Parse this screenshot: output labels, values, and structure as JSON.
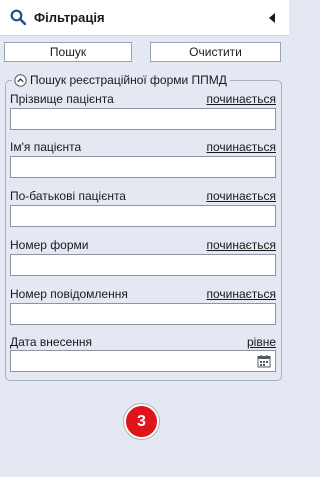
{
  "header": {
    "title": "Фільтрація",
    "search_icon": "search-icon",
    "collapse_icon": "triangle-left-icon"
  },
  "toolbar": {
    "search_label": "Пошук",
    "clear_label": "Очистити"
  },
  "group": {
    "legend": "Пошук реєстраційної форми ППМД",
    "legend_icon": "chevron-up-circle-icon"
  },
  "fields": [
    {
      "label": "Прізвище пацієнта",
      "mode": "починається",
      "value": ""
    },
    {
      "label": "Ім'я пацієнта",
      "mode": "починається",
      "value": ""
    },
    {
      "label": "По-батькові пацієнта",
      "mode": "починається",
      "value": ""
    },
    {
      "label": "Номер форми",
      "mode": "починається",
      "value": ""
    },
    {
      "label": "Номер повідомлення",
      "mode": "починається",
      "value": ""
    },
    {
      "label": "Дата внесення",
      "mode": "рівне",
      "value": "",
      "icon": "calendar-icon"
    }
  ],
  "step_badge": "3",
  "colors": {
    "background": "#e3e8f3",
    "badge": "#e0141b",
    "icon_blue": "#1f4e8c"
  }
}
